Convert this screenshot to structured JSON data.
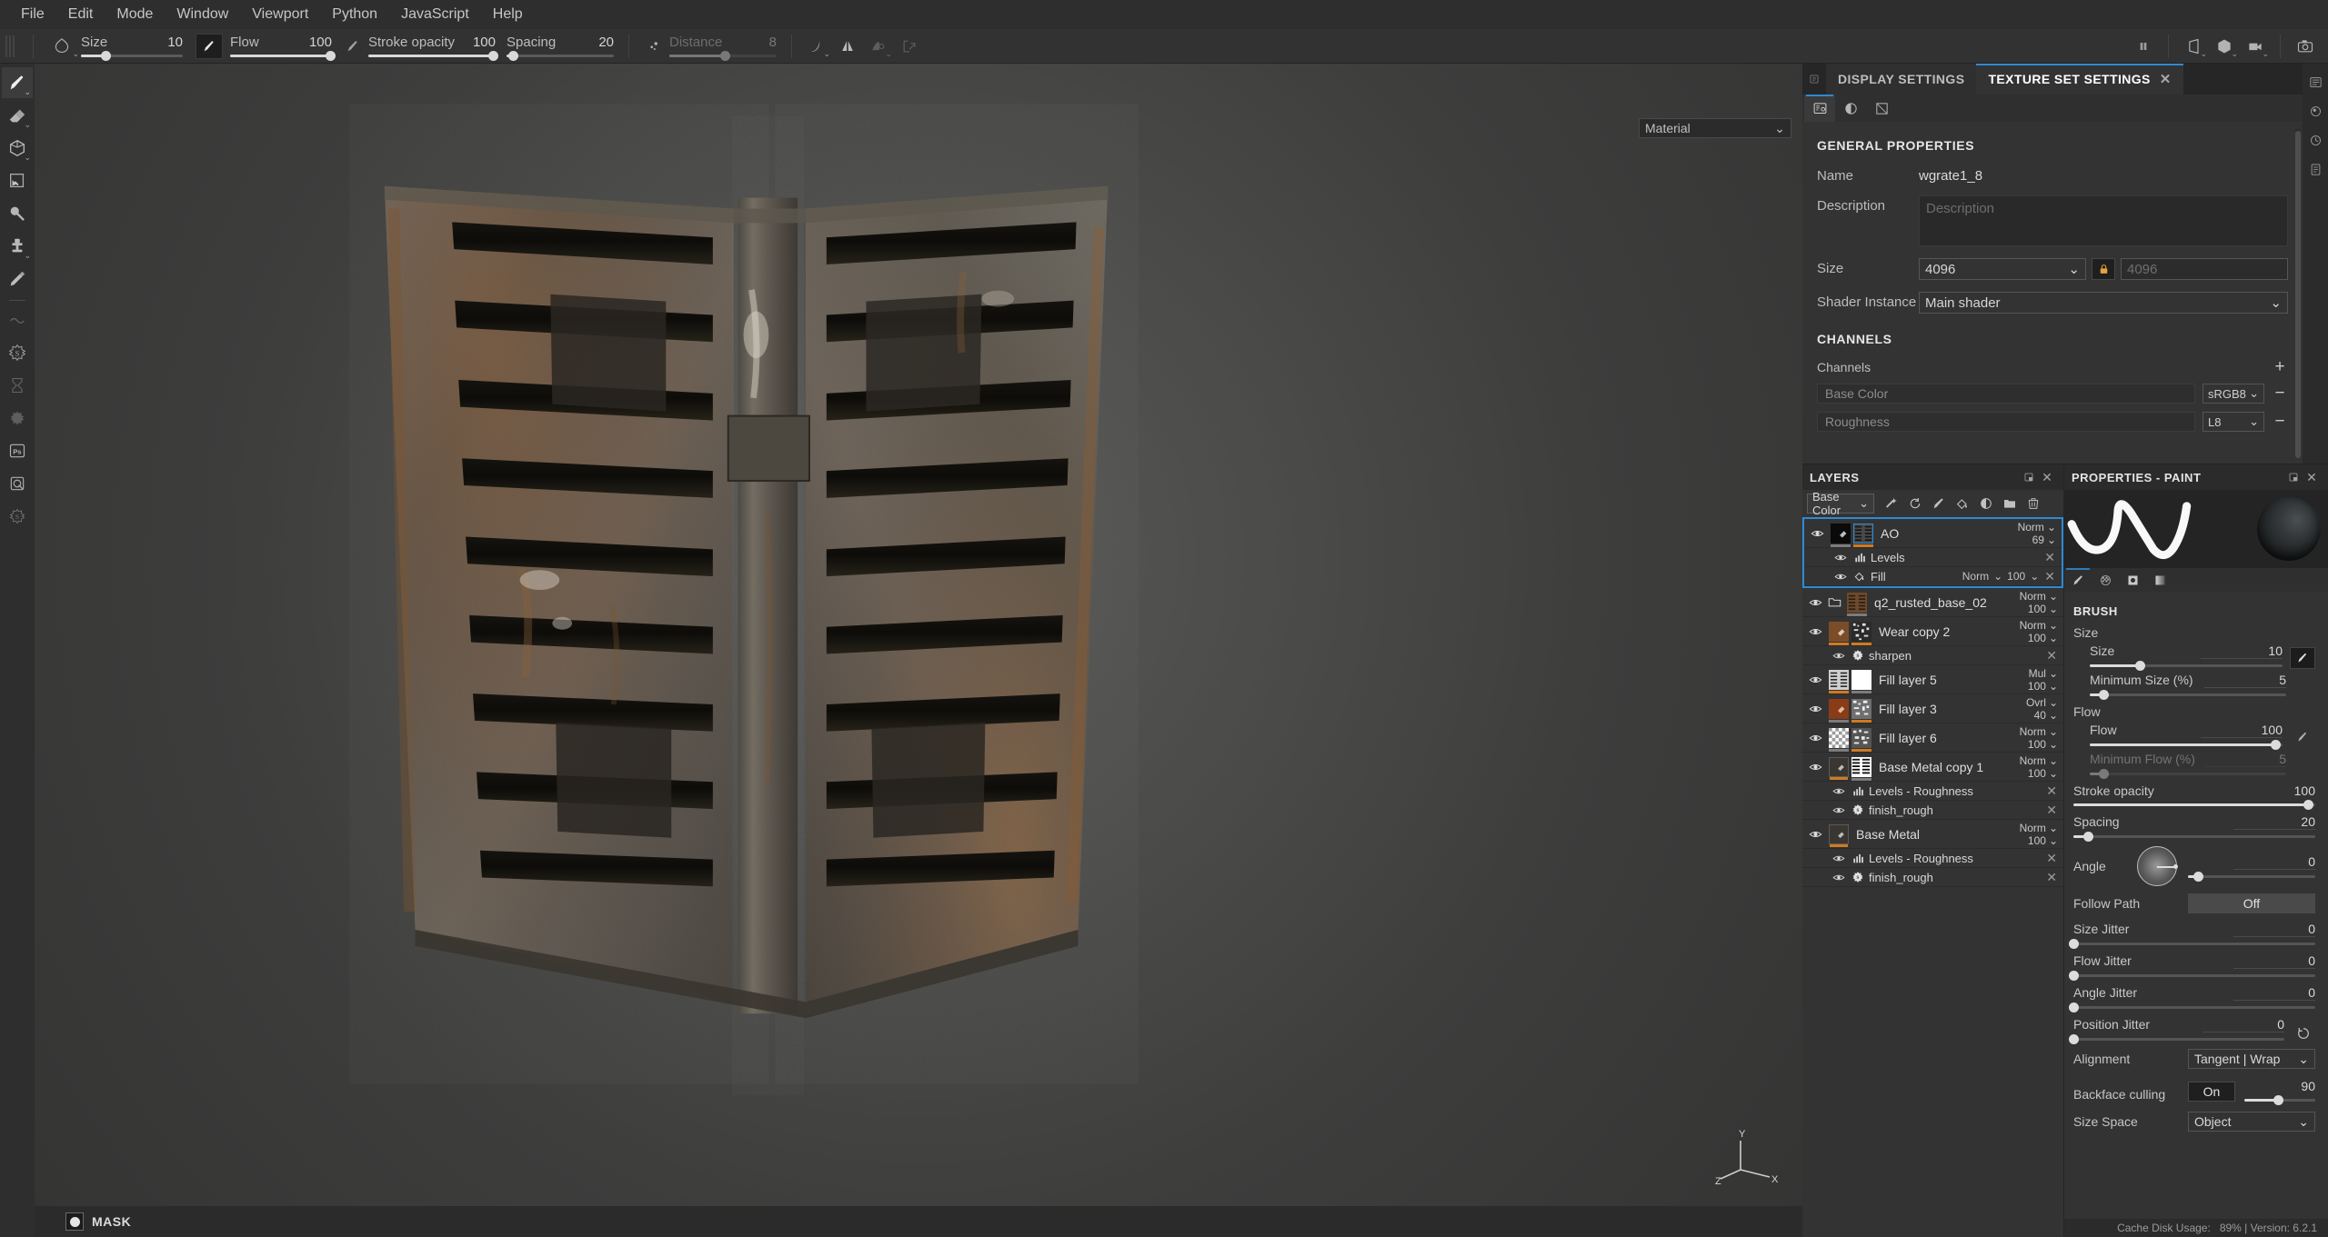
{
  "menubar": {
    "items": [
      {
        "label": "File"
      },
      {
        "label": "Edit"
      },
      {
        "label": "Mode"
      },
      {
        "label": "Window"
      },
      {
        "label": "Viewport"
      },
      {
        "label": "Python"
      },
      {
        "label": "JavaScript"
      },
      {
        "label": "Help"
      }
    ]
  },
  "toolbar": {
    "size": {
      "label": "Size",
      "value": "10",
      "pct": 24
    },
    "flow": {
      "label": "Flow",
      "value": "100",
      "pct": 98
    },
    "stroke_opacity": {
      "label": "Stroke opacity",
      "value": "100",
      "pct": 98
    },
    "spacing": {
      "label": "Spacing",
      "value": "20",
      "pct": 6
    },
    "distance": {
      "label": "Distance",
      "value": "8",
      "pct": 52
    },
    "icons": [
      {
        "name": "brush-stamp-icon"
      },
      {
        "name": "symmetry-icon"
      },
      {
        "name": "symmetry-options-icon"
      },
      {
        "name": "projection-icon"
      }
    ],
    "right_icons": [
      {
        "name": "pause-engine-icon"
      },
      {
        "name": "camera-perspective-icon"
      },
      {
        "name": "render-mode-icon"
      },
      {
        "name": "viewport-camera-icon"
      },
      {
        "name": "screenshot-icon"
      }
    ]
  },
  "left_tools": [
    {
      "name": "paint-brush-tool",
      "label": "Paint",
      "active": true,
      "caret": true
    },
    {
      "name": "eraser-tool",
      "label": "Eraser",
      "active": false,
      "caret": true
    },
    {
      "name": "projection-tool",
      "label": "Projection",
      "active": false,
      "caret": true
    },
    {
      "name": "polygon-fill-tool",
      "label": "Polygon Fill",
      "active": false,
      "caret": false
    },
    {
      "name": "geometry-decal-tool",
      "label": "Geometry Decal",
      "active": false,
      "caret": false
    },
    {
      "name": "clone-stamp-tool",
      "label": "Clone Stamp",
      "active": false,
      "caret": true
    },
    {
      "name": "material-picker-tool",
      "label": "Material Picker",
      "active": false,
      "caret": false
    },
    {
      "name": "smudge-tool",
      "label": "Smudge",
      "active": false,
      "caret": false
    },
    {
      "name": "particle-tool",
      "label": "Particles",
      "active": false,
      "caret": false
    },
    {
      "name": "baking-tool",
      "label": "Baking",
      "active": false,
      "caret": false
    },
    {
      "name": "substance-tool",
      "label": "Substance",
      "active": false,
      "caret": false
    },
    {
      "name": "photoshop-link-tool",
      "label": "Photoshop",
      "active": false,
      "caret": false
    },
    {
      "name": "iray-render-tool",
      "label": "Iray Render",
      "active": false,
      "caret": false
    },
    {
      "name": "substance-source-tool",
      "label": "Source",
      "active": false,
      "caret": false
    }
  ],
  "viewport": {
    "material_dropdown": "Material",
    "status_label": "MASK",
    "gizmo": {
      "x": "X",
      "y": "Y",
      "z": "Z"
    }
  },
  "right_rail": [
    {
      "name": "list-view-icon"
    },
    {
      "name": "shelf-icon"
    },
    {
      "name": "history-icon"
    },
    {
      "name": "log-icon"
    }
  ],
  "texture_set_settings": {
    "tabs": [
      {
        "label": "DISPLAY SETTINGS",
        "active": false
      },
      {
        "label": "TEXTURE SET SETTINGS",
        "active": true,
        "closable": true
      }
    ],
    "subtabs": [
      {
        "name": "texture-set-settings-icon",
        "active": true
      },
      {
        "name": "display-settings-icon",
        "active": false
      },
      {
        "name": "uv-tile-icon",
        "active": false
      }
    ],
    "general_properties": {
      "title": "GENERAL PROPERTIES",
      "name_label": "Name",
      "name_value": "wgrate1_8",
      "description_label": "Description",
      "description_placeholder": "Description",
      "size_label": "Size",
      "size_value": "4096",
      "size_value2": "4096",
      "shader_label": "Shader Instance",
      "shader_value": "Main shader"
    },
    "channels": {
      "title": "CHANNELS",
      "list_label": "Channels",
      "add_label": "+",
      "rows": [
        {
          "name": "Base Color",
          "format": "sRGB8"
        },
        {
          "name": "Roughness",
          "format": "L8"
        }
      ]
    }
  },
  "layers_panel": {
    "title": "LAYERS",
    "channel_selector": "Base Color",
    "tools": [
      {
        "name": "add-effect-icon"
      },
      {
        "name": "add-fill-layer-icon"
      },
      {
        "name": "add-paint-layer-icon"
      },
      {
        "name": "add-fill-icon"
      },
      {
        "name": "add-mask-icon"
      },
      {
        "name": "add-folder-icon"
      },
      {
        "name": "delete-layer-icon"
      }
    ],
    "layers": [
      {
        "name": "AO",
        "blend": "Norm",
        "opacity": "69",
        "selected": true,
        "type": "fill",
        "thumbs": [
          {
            "kind": "mask",
            "bar": "grey"
          },
          {
            "kind": "grate",
            "bar": "orange",
            "selected": true
          }
        ],
        "effects": [
          {
            "name": "Levels",
            "icon": "levels-icon"
          },
          {
            "name": "Fill",
            "icon": "fill-icon",
            "blend": "Norm",
            "opacity": "100"
          }
        ]
      },
      {
        "name": "q2_rusted_base_02",
        "blend": "Norm",
        "opacity": "100",
        "selected": false,
        "type": "folder",
        "thumbs": [
          {
            "kind": "grate-rust",
            "bar": "grey"
          }
        ],
        "effects": []
      },
      {
        "name": "Wear copy 2",
        "blend": "Norm",
        "opacity": "100",
        "selected": false,
        "type": "fill",
        "thumbs": [
          {
            "kind": "rust",
            "bar": "orange"
          },
          {
            "kind": "noise",
            "bar": "orange"
          }
        ],
        "effects": [
          {
            "name": "sharpen",
            "icon": "substance-filter-icon"
          }
        ]
      },
      {
        "name": "Fill layer 5",
        "blend": "Mul",
        "opacity": "100",
        "selected": false,
        "type": "fill",
        "thumbs": [
          {
            "kind": "grate-light",
            "bar": "orange"
          },
          {
            "kind": "white",
            "bar": "grey"
          }
        ],
        "effects": []
      },
      {
        "name": "Fill layer 3",
        "blend": "Ovrl",
        "opacity": "40",
        "selected": false,
        "type": "fill",
        "thumbs": [
          {
            "kind": "rust-solid",
            "bar": "grey"
          },
          {
            "kind": "noise",
            "bar": "orange"
          }
        ],
        "effects": []
      },
      {
        "name": "Fill layer 6",
        "blend": "Norm",
        "opacity": "100",
        "selected": false,
        "type": "fill",
        "thumbs": [
          {
            "kind": "checker",
            "bar": "grey"
          },
          {
            "kind": "noise",
            "bar": "orange"
          }
        ],
        "effects": []
      },
      {
        "name": "Base Metal copy 1",
        "blend": "Norm",
        "opacity": "100",
        "selected": false,
        "type": "fill",
        "thumbs": [
          {
            "kind": "dark",
            "bar": "orange"
          },
          {
            "kind": "grate-bw",
            "bar": "grey"
          }
        ],
        "effects": [
          {
            "name": "Levels - Roughness",
            "icon": "levels-icon"
          },
          {
            "name": "finish_rough",
            "icon": "substance-filter-icon"
          }
        ]
      },
      {
        "name": "Base Metal",
        "blend": "Norm",
        "opacity": "100",
        "selected": false,
        "type": "fill",
        "thumbs": [
          {
            "kind": "dark",
            "bar": "orange"
          }
        ],
        "effects": [
          {
            "name": "Levels - Roughness",
            "icon": "levels-icon"
          },
          {
            "name": "finish_rough",
            "icon": "substance-filter-icon"
          }
        ]
      }
    ]
  },
  "properties_panel": {
    "title": "PROPERTIES - PAINT",
    "subtabs": [
      {
        "name": "brush-tab-icon",
        "active": true
      },
      {
        "name": "alpha-tab-icon",
        "active": false
      },
      {
        "name": "stencil-tab-icon",
        "active": false
      },
      {
        "name": "material-tab-icon",
        "active": false
      }
    ],
    "brush": {
      "group_title": "BRUSH",
      "size_group": "Size",
      "size": {
        "label": "Size",
        "value": "10",
        "pct": 26
      },
      "minimum_size": {
        "label": "Minimum Size (%)",
        "value": "5",
        "pct": 7
      },
      "flow_group": "Flow",
      "flow": {
        "label": "Flow",
        "value": "100",
        "pct": 96
      },
      "minimum_flow": {
        "label": "Minimum Flow (%)",
        "value": "5",
        "pct": 7,
        "disabled": true
      },
      "stroke_opacity": {
        "label": "Stroke opacity",
        "value": "100",
        "pct": 97
      },
      "spacing": {
        "label": "Spacing",
        "value": "20",
        "pct": 6
      },
      "angle": {
        "label": "Angle",
        "value": "0",
        "pct": 8
      },
      "follow_path": {
        "label": "Follow Path",
        "value": "Off"
      },
      "size_jitter": {
        "label": "Size Jitter",
        "value": "0",
        "pct": 0
      },
      "flow_jitter": {
        "label": "Flow Jitter",
        "value": "0",
        "pct": 0
      },
      "angle_jitter": {
        "label": "Angle Jitter",
        "value": "0",
        "pct": 0
      },
      "position_jitter": {
        "label": "Position Jitter",
        "value": "0",
        "pct": 0
      },
      "alignment": {
        "label": "Alignment",
        "value": "Tangent | Wrap"
      },
      "backface_culling": {
        "label": "Backface culling",
        "value": "On",
        "slider_value": "90",
        "pct": 48
      },
      "size_space": {
        "label": "Size Space",
        "value": "Object"
      }
    }
  },
  "footer": {
    "cache_label": "Cache Disk Usage:",
    "cache_value": "89% | Version: 6.2.1"
  },
  "colors": {
    "accent": "#2c8ad6",
    "orange": "#d07a20",
    "panel_bg": "#333333",
    "window_bg": "#2b2b2b"
  }
}
